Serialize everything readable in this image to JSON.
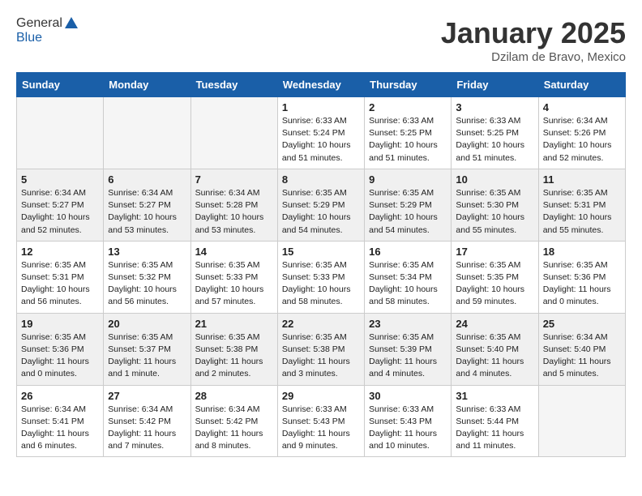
{
  "header": {
    "logo_general": "General",
    "logo_blue": "Blue",
    "month": "January 2025",
    "location": "Dzilam de Bravo, Mexico"
  },
  "weekdays": [
    "Sunday",
    "Monday",
    "Tuesday",
    "Wednesday",
    "Thursday",
    "Friday",
    "Saturday"
  ],
  "weeks": [
    [
      {
        "day": "",
        "info": ""
      },
      {
        "day": "",
        "info": ""
      },
      {
        "day": "",
        "info": ""
      },
      {
        "day": "1",
        "info": "Sunrise: 6:33 AM\nSunset: 5:24 PM\nDaylight: 10 hours\nand 51 minutes."
      },
      {
        "day": "2",
        "info": "Sunrise: 6:33 AM\nSunset: 5:25 PM\nDaylight: 10 hours\nand 51 minutes."
      },
      {
        "day": "3",
        "info": "Sunrise: 6:33 AM\nSunset: 5:25 PM\nDaylight: 10 hours\nand 51 minutes."
      },
      {
        "day": "4",
        "info": "Sunrise: 6:34 AM\nSunset: 5:26 PM\nDaylight: 10 hours\nand 52 minutes."
      }
    ],
    [
      {
        "day": "5",
        "info": "Sunrise: 6:34 AM\nSunset: 5:27 PM\nDaylight: 10 hours\nand 52 minutes."
      },
      {
        "day": "6",
        "info": "Sunrise: 6:34 AM\nSunset: 5:27 PM\nDaylight: 10 hours\nand 53 minutes."
      },
      {
        "day": "7",
        "info": "Sunrise: 6:34 AM\nSunset: 5:28 PM\nDaylight: 10 hours\nand 53 minutes."
      },
      {
        "day": "8",
        "info": "Sunrise: 6:35 AM\nSunset: 5:29 PM\nDaylight: 10 hours\nand 54 minutes."
      },
      {
        "day": "9",
        "info": "Sunrise: 6:35 AM\nSunset: 5:29 PM\nDaylight: 10 hours\nand 54 minutes."
      },
      {
        "day": "10",
        "info": "Sunrise: 6:35 AM\nSunset: 5:30 PM\nDaylight: 10 hours\nand 55 minutes."
      },
      {
        "day": "11",
        "info": "Sunrise: 6:35 AM\nSunset: 5:31 PM\nDaylight: 10 hours\nand 55 minutes."
      }
    ],
    [
      {
        "day": "12",
        "info": "Sunrise: 6:35 AM\nSunset: 5:31 PM\nDaylight: 10 hours\nand 56 minutes."
      },
      {
        "day": "13",
        "info": "Sunrise: 6:35 AM\nSunset: 5:32 PM\nDaylight: 10 hours\nand 56 minutes."
      },
      {
        "day": "14",
        "info": "Sunrise: 6:35 AM\nSunset: 5:33 PM\nDaylight: 10 hours\nand 57 minutes."
      },
      {
        "day": "15",
        "info": "Sunrise: 6:35 AM\nSunset: 5:33 PM\nDaylight: 10 hours\nand 58 minutes."
      },
      {
        "day": "16",
        "info": "Sunrise: 6:35 AM\nSunset: 5:34 PM\nDaylight: 10 hours\nand 58 minutes."
      },
      {
        "day": "17",
        "info": "Sunrise: 6:35 AM\nSunset: 5:35 PM\nDaylight: 10 hours\nand 59 minutes."
      },
      {
        "day": "18",
        "info": "Sunrise: 6:35 AM\nSunset: 5:36 PM\nDaylight: 11 hours\nand 0 minutes."
      }
    ],
    [
      {
        "day": "19",
        "info": "Sunrise: 6:35 AM\nSunset: 5:36 PM\nDaylight: 11 hours\nand 0 minutes."
      },
      {
        "day": "20",
        "info": "Sunrise: 6:35 AM\nSunset: 5:37 PM\nDaylight: 11 hours\nand 1 minute."
      },
      {
        "day": "21",
        "info": "Sunrise: 6:35 AM\nSunset: 5:38 PM\nDaylight: 11 hours\nand 2 minutes."
      },
      {
        "day": "22",
        "info": "Sunrise: 6:35 AM\nSunset: 5:38 PM\nDaylight: 11 hours\nand 3 minutes."
      },
      {
        "day": "23",
        "info": "Sunrise: 6:35 AM\nSunset: 5:39 PM\nDaylight: 11 hours\nand 4 minutes."
      },
      {
        "day": "24",
        "info": "Sunrise: 6:35 AM\nSunset: 5:40 PM\nDaylight: 11 hours\nand 4 minutes."
      },
      {
        "day": "25",
        "info": "Sunrise: 6:34 AM\nSunset: 5:40 PM\nDaylight: 11 hours\nand 5 minutes."
      }
    ],
    [
      {
        "day": "26",
        "info": "Sunrise: 6:34 AM\nSunset: 5:41 PM\nDaylight: 11 hours\nand 6 minutes."
      },
      {
        "day": "27",
        "info": "Sunrise: 6:34 AM\nSunset: 5:42 PM\nDaylight: 11 hours\nand 7 minutes."
      },
      {
        "day": "28",
        "info": "Sunrise: 6:34 AM\nSunset: 5:42 PM\nDaylight: 11 hours\nand 8 minutes."
      },
      {
        "day": "29",
        "info": "Sunrise: 6:33 AM\nSunset: 5:43 PM\nDaylight: 11 hours\nand 9 minutes."
      },
      {
        "day": "30",
        "info": "Sunrise: 6:33 AM\nSunset: 5:43 PM\nDaylight: 11 hours\nand 10 minutes."
      },
      {
        "day": "31",
        "info": "Sunrise: 6:33 AM\nSunset: 5:44 PM\nDaylight: 11 hours\nand 11 minutes."
      },
      {
        "day": "",
        "info": ""
      }
    ]
  ]
}
